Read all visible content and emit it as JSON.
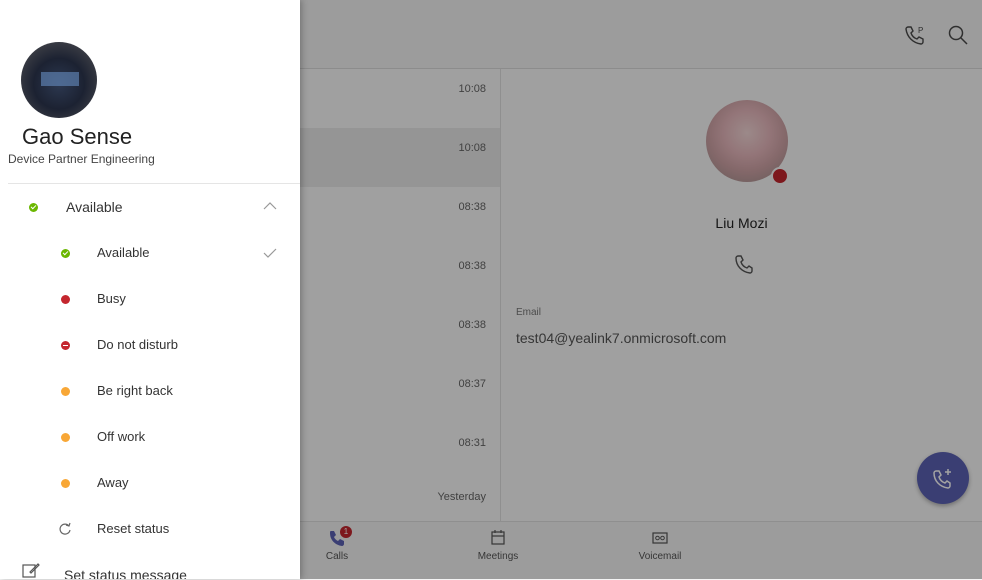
{
  "colors": {
    "available": "#6bb700",
    "busy": "#c4262e",
    "away": "#f8a736",
    "accent": "#5c62b5"
  },
  "background": {
    "call_times": [
      "10:08",
      "10:08",
      "08:38",
      "08:38",
      "08:38",
      "08:37",
      "08:31",
      "Yesterday"
    ],
    "detail": {
      "name": "Liu Mozi",
      "email_label": "Email",
      "email_value": "test04@yealink7.onmicrosoft.com"
    },
    "nav": {
      "calls": "Calls",
      "calls_badge": "1",
      "meetings": "Meetings",
      "voicemail": "Voicemail"
    }
  },
  "drawer": {
    "user_name": "Gao Sense",
    "user_org": "Device Partner Engineering",
    "current_status": "Available",
    "status_options": [
      {
        "label": "Available",
        "icon": "available-dot-icon",
        "color": "#6bb700",
        "selected": true
      },
      {
        "label": "Busy",
        "icon": "busy-dot-icon",
        "color": "#c4262e"
      },
      {
        "label": "Do not disturb",
        "icon": "dnd-dot-icon",
        "color": "#c4262e"
      },
      {
        "label": "Be right back",
        "icon": "brb-dot-icon",
        "color": "#f8a736"
      },
      {
        "label": "Off work",
        "icon": "offwork-dot-icon",
        "color": "#f8a736"
      },
      {
        "label": "Away",
        "icon": "away-dot-icon",
        "color": "#f8a736"
      },
      {
        "label": "Reset status",
        "icon": "reset-icon"
      }
    ],
    "set_status_message": "Set status message"
  }
}
